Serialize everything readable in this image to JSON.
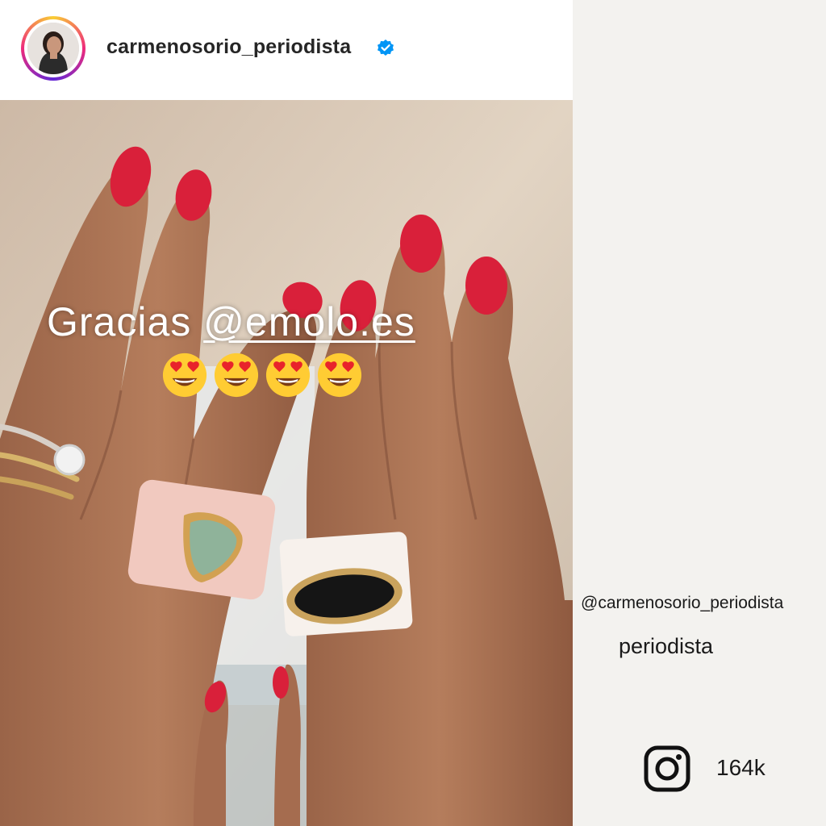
{
  "post": {
    "username": "carmenosorio_periodista",
    "verified_icon": "verified-badge-icon",
    "caption_prefix": "Gracias ",
    "caption_mention": "@emolo.es",
    "emoji_count": 4,
    "emoji_name": "heart-eyes-emoji"
  },
  "profile": {
    "handle": "@carmenosorio_periodista",
    "role": "periodista",
    "followers": "164k",
    "platform_icon": "instagram-icon"
  },
  "colors": {
    "verified_blue": "#0095f6",
    "nail_red": "#d9203a",
    "background": "#f3f2ef"
  }
}
